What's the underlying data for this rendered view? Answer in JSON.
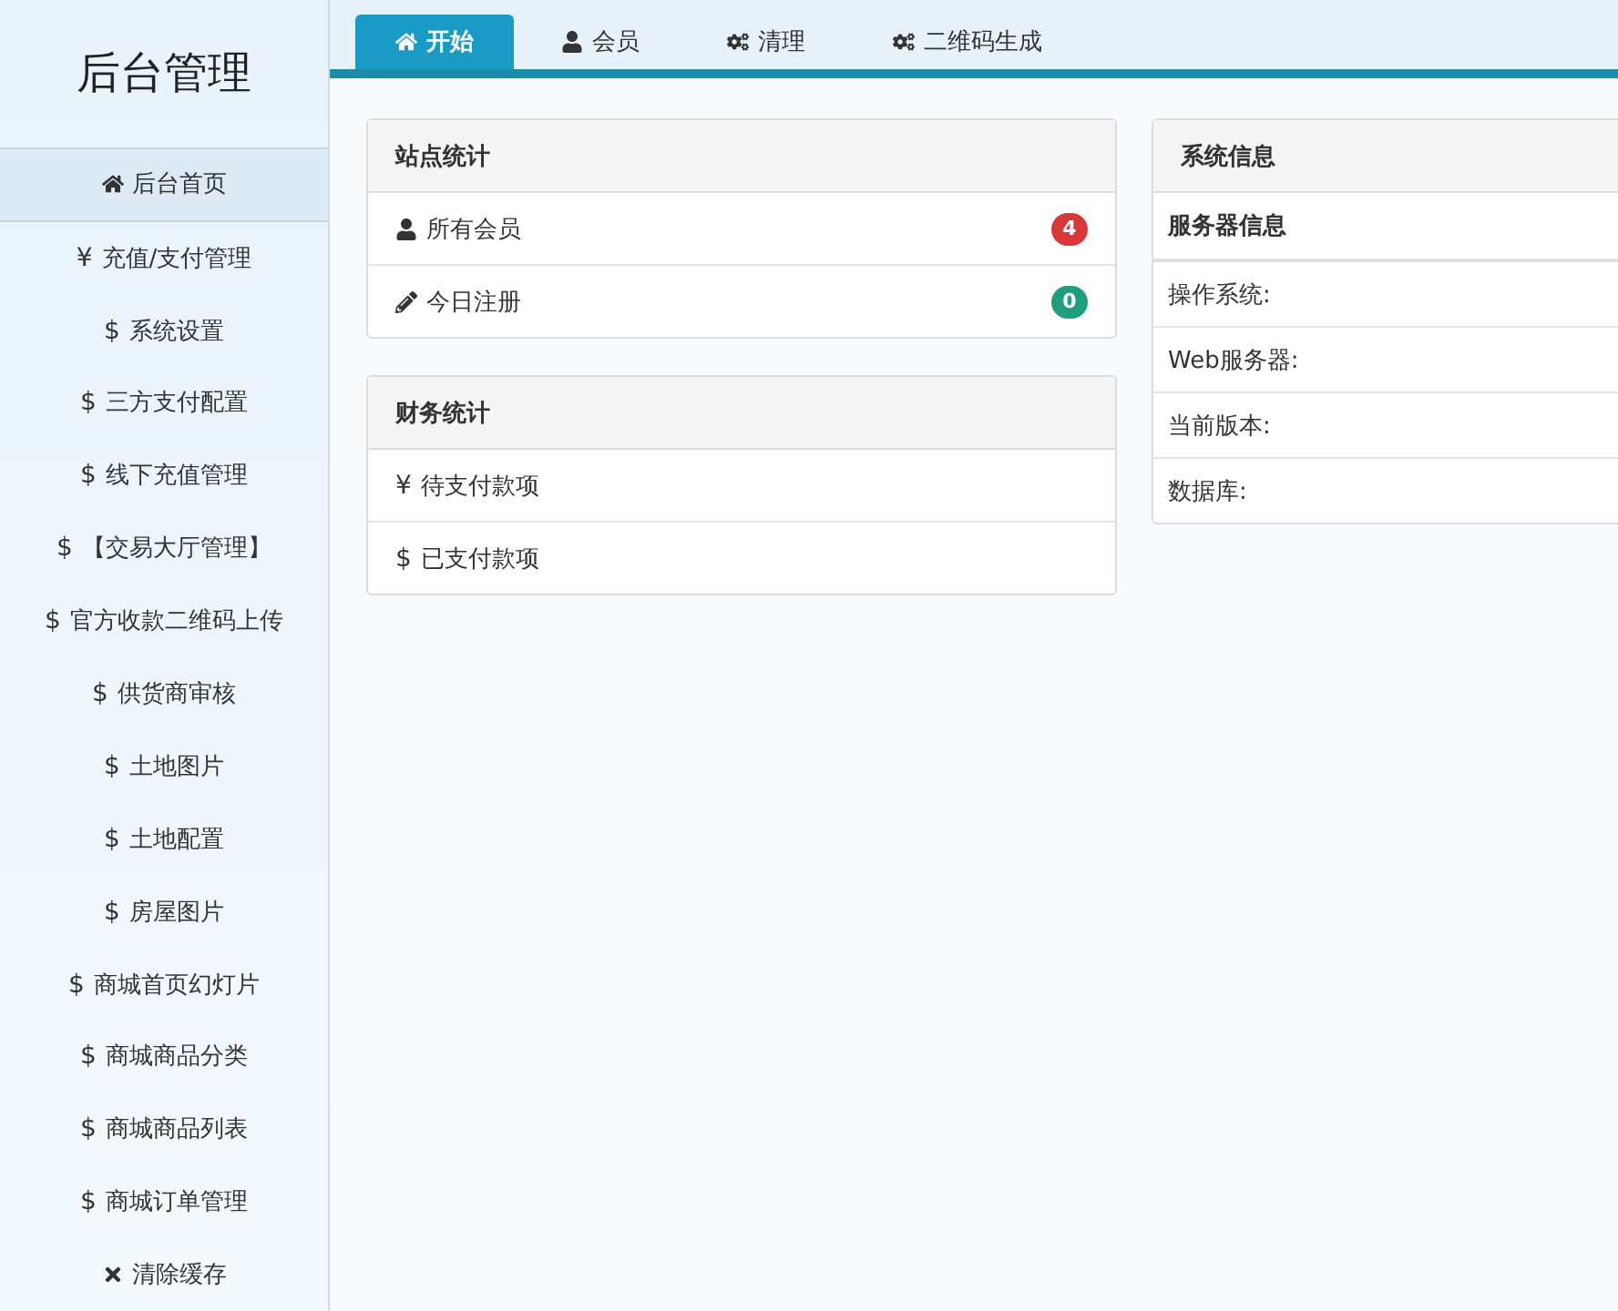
{
  "sidebar": {
    "title": "后台管理",
    "items": [
      {
        "kind": "home",
        "label": "后台首页",
        "selected": true
      },
      {
        "symbol": "¥",
        "label": "充值/支付管理",
        "selected": false
      },
      {
        "symbol": "$",
        "label": "系统设置",
        "selected": false
      },
      {
        "symbol": "$",
        "label": "三方支付配置",
        "selected": false
      },
      {
        "symbol": "$",
        "label": "线下充值管理",
        "selected": false
      },
      {
        "symbol": "$",
        "label": "【交易大厅管理】",
        "selected": false
      },
      {
        "symbol": "$",
        "label": "官方收款二维码上传",
        "selected": false
      },
      {
        "symbol": "$",
        "label": "供货商审核",
        "selected": false
      },
      {
        "symbol": "$",
        "label": "土地图片",
        "selected": false
      },
      {
        "symbol": "$",
        "label": "土地配置",
        "selected": false
      },
      {
        "symbol": "$",
        "label": "房屋图片",
        "selected": false
      },
      {
        "symbol": "$",
        "label": "商城首页幻灯片",
        "selected": false
      },
      {
        "symbol": "$",
        "label": "商城商品分类",
        "selected": false
      },
      {
        "symbol": "$",
        "label": "商城商品列表",
        "selected": false
      },
      {
        "symbol": "$",
        "label": "商城订单管理",
        "selected": false
      },
      {
        "kind": "times",
        "label": "清除缓存",
        "selected": false
      }
    ]
  },
  "tabs": [
    {
      "kind": "home",
      "label": "开始",
      "selected": true
    },
    {
      "kind": "user",
      "label": "会员",
      "selected": false
    },
    {
      "kind": "cogs",
      "label": "清理",
      "selected": false
    },
    {
      "kind": "cogs",
      "label": "二维码生成",
      "selected": false
    }
  ],
  "site_stats": {
    "title": "站点统计",
    "rows": [
      {
        "kind": "user",
        "label": "所有会员",
        "count": "4",
        "color": "#d9383a"
      },
      {
        "kind": "pencil",
        "label": "今日注册",
        "count": "0",
        "color": "#1e9e7a"
      }
    ]
  },
  "finance_stats": {
    "title": "财务统计",
    "rows": [
      {
        "symbol": "¥",
        "label": "待支付款项"
      },
      {
        "symbol": "$",
        "label": "已支付款项"
      }
    ]
  },
  "system_info": {
    "title": "系统信息",
    "subtitle": "服务器信息",
    "rows": [
      {
        "label": "操作系统:"
      },
      {
        "label": "Web服务器:"
      },
      {
        "label": "当前版本:"
      },
      {
        "label": "数据库:"
      }
    ]
  }
}
